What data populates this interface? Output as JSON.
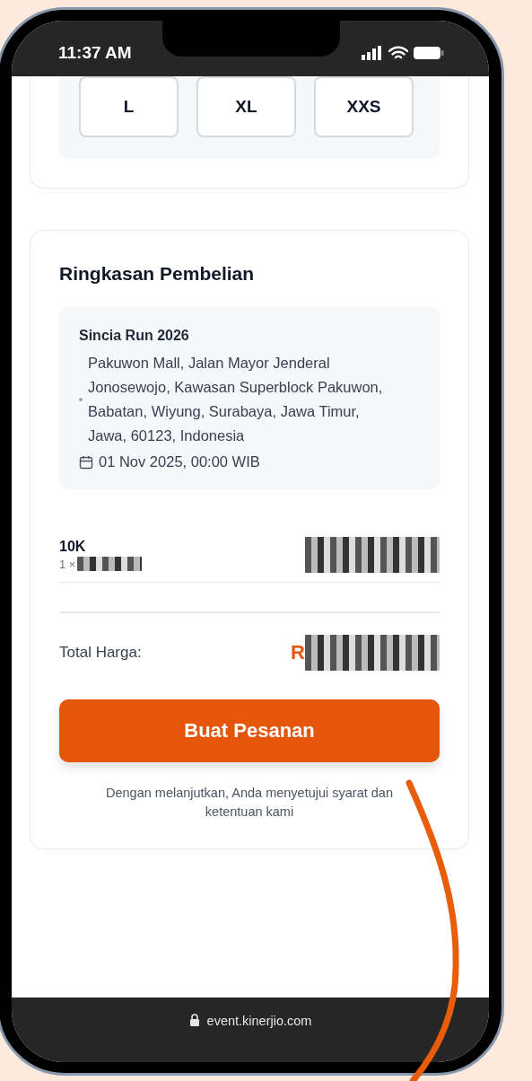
{
  "status_bar": {
    "time": "11:37 AM"
  },
  "sizes": [
    {
      "label": "L",
      "selected": false
    },
    {
      "label": "XL",
      "selected": false
    },
    {
      "label": "XXS",
      "selected": false
    }
  ],
  "summary": {
    "title": "Ringkasan Pembelian",
    "event": {
      "name": "Sincia Run 2026",
      "address": "Pakuwon Mall, Jalan Mayor Jenderal Jonosewojo, Kawasan Superblock Pakuwon, Babatan, Wiyung, Surabaya, Jawa Timur, Jawa, 60123, Indonesia",
      "date": "01 Nov 2025, 00:00 WIB"
    },
    "items": [
      {
        "name": "10K",
        "quantity": "1 ×"
      }
    ],
    "total_label": "Total Harga:",
    "total_prefix": "R",
    "button": "Buat Pesanan",
    "terms": "Dengan melanjutkan, Anda menyetujui syarat dan ketentuan kami"
  },
  "browser": {
    "url": "event.kinerjio.com"
  }
}
